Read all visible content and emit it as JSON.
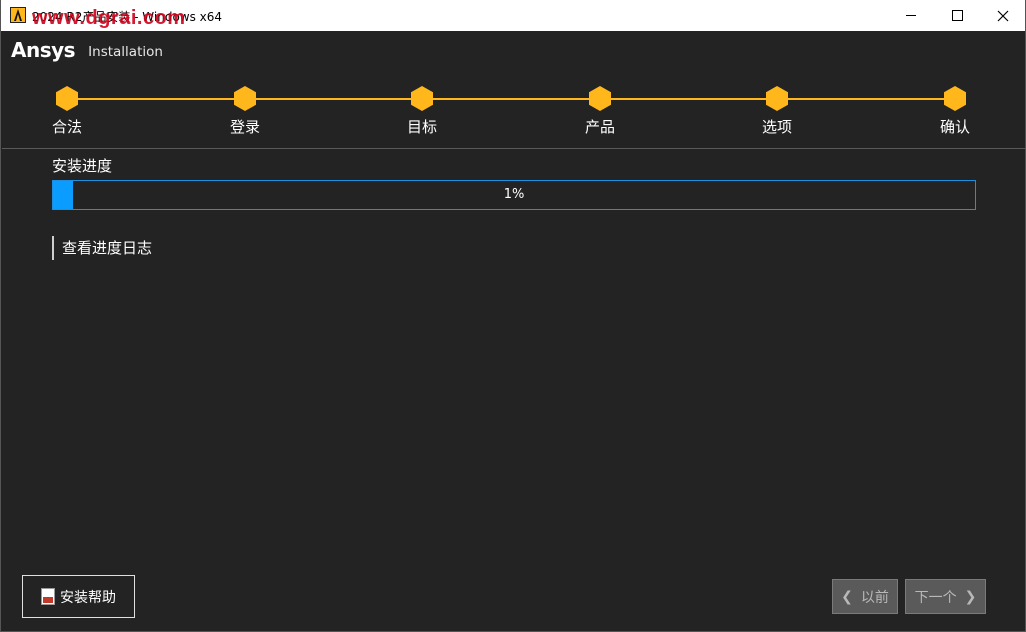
{
  "window": {
    "title": "2024 R2产品安装 - Windows x64",
    "watermark": "www.dgrai.com"
  },
  "brand": {
    "logo": "Ansys",
    "subtitle": "Installation"
  },
  "colors": {
    "accent": "#ffb71b",
    "progress": "#0a9cff",
    "background": "#232323"
  },
  "steps": [
    {
      "label": "合法",
      "icon": "hexagon-step"
    },
    {
      "label": "登录",
      "icon": "hexagon-step"
    },
    {
      "label": "目标",
      "icon": "hexagon-step"
    },
    {
      "label": "产品",
      "icon": "hexagon-step"
    },
    {
      "label": "选项",
      "icon": "hexagon-step"
    },
    {
      "label": "确认",
      "icon": "hexagon-step"
    }
  ],
  "progress": {
    "title": "安装进度",
    "value": 1,
    "text": "1%"
  },
  "log_link": "查看进度日志",
  "footer": {
    "help_label": "安装帮助",
    "prev_label": "以前",
    "next_label": "下一个"
  }
}
